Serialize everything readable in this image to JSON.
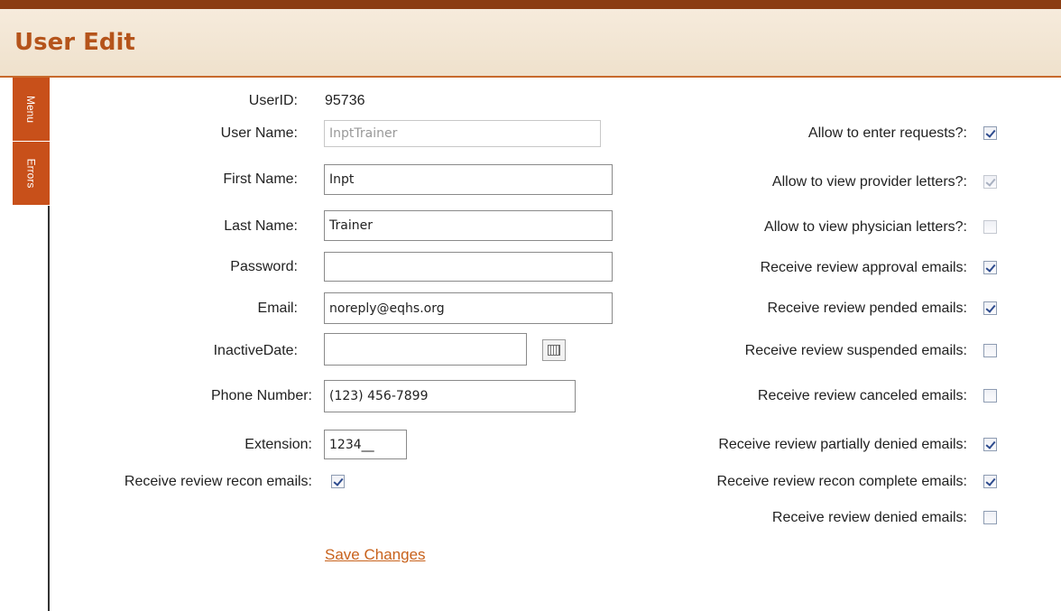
{
  "header": {
    "title": "User Edit"
  },
  "sidebar": {
    "tabs": [
      {
        "label": "Menu"
      },
      {
        "label": "Errors"
      }
    ]
  },
  "form": {
    "userid": {
      "label": "UserID:",
      "value": "95736"
    },
    "user_name": {
      "label": "User Name:",
      "value": "InptTrainer"
    },
    "first_name": {
      "label": "First Name:",
      "value": "Inpt"
    },
    "last_name": {
      "label": "Last Name:",
      "value": "Trainer"
    },
    "password": {
      "label": "Password:",
      "value": ""
    },
    "email": {
      "label": "Email:",
      "value": "noreply@eqhs.org"
    },
    "inactive_date": {
      "label": "InactiveDate:",
      "value": "",
      "calendar_icon": "calendar-icon"
    },
    "phone": {
      "label": "Phone Number:",
      "value": "(123) 456-7899"
    },
    "extension": {
      "label": "Extension:",
      "value": "1234__"
    },
    "recon_emails": {
      "label": "Receive review recon emails:",
      "checked": true
    }
  },
  "permissions": [
    {
      "label": "Allow to enter requests?:",
      "checked": true,
      "disabled": false
    },
    {
      "label": "Allow to view provider letters?:",
      "checked": true,
      "disabled": true
    },
    {
      "label": "Allow to view physician letters?:",
      "checked": false,
      "disabled": true
    },
    {
      "label": "Receive review approval emails:",
      "checked": true,
      "disabled": false
    },
    {
      "label": "Receive review pended emails:",
      "checked": true,
      "disabled": false
    },
    {
      "label": "Receive review suspended emails:",
      "checked": false,
      "disabled": false
    },
    {
      "label": "Receive review canceled emails:",
      "checked": false,
      "disabled": false
    },
    {
      "label": "Receive review partially denied emails:",
      "checked": true,
      "disabled": false
    },
    {
      "label": "Receive review recon complete emails:",
      "checked": true,
      "disabled": false
    },
    {
      "label": "Receive review denied emails:",
      "checked": false,
      "disabled": false
    }
  ],
  "actions": {
    "save_label": "Save Changes"
  },
  "colors": {
    "accent": "#c8501a",
    "title": "#b5541b",
    "link": "#c8621c"
  }
}
